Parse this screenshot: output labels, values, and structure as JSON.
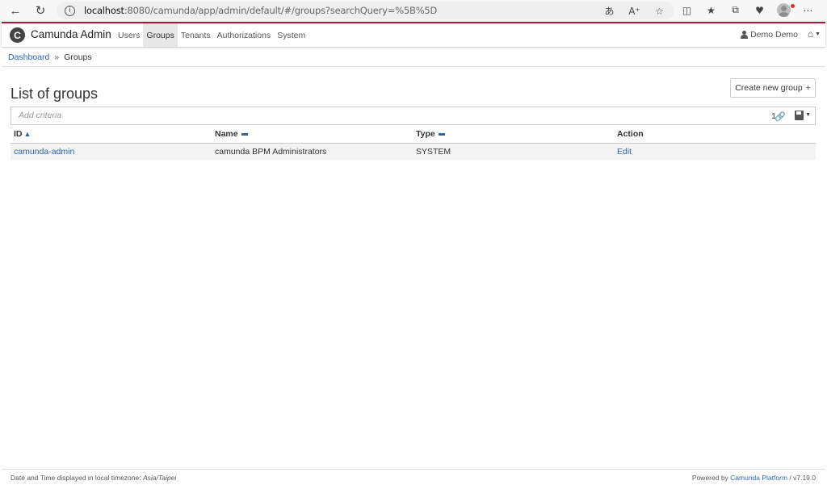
{
  "browser": {
    "url_host": "localhost",
    "url_rest": ":8080/camunda/app/admin/default/#/groups?searchQuery=%5B%5D"
  },
  "header": {
    "brand": "Camunda Admin",
    "nav": [
      "Users",
      "Groups",
      "Tenants",
      "Authorizations",
      "System"
    ],
    "active_nav": "Groups",
    "user": "Demo Demo"
  },
  "breadcrumb": {
    "dashboard": "Dashboard",
    "separator": "»",
    "current": "Groups"
  },
  "main": {
    "title": "List of groups",
    "create_button": "Create new group",
    "search_placeholder": "Add criteria",
    "result_count": "1"
  },
  "table": {
    "headers": [
      "ID",
      "Name",
      "Type",
      "Action"
    ],
    "rows": [
      {
        "id": "camunda-admin",
        "name": "camunda BPM Administrators",
        "type": "SYSTEM",
        "action": "Edit"
      }
    ]
  },
  "footer": {
    "left_prefix": "Date and Time displayed in local timezone: ",
    "timezone": "Asia/Taipei",
    "right_prefix": "Powered by ",
    "right_link": "Camunda Platform",
    "version": " / v7.19.0"
  },
  "colors": {
    "accent": "#b5152b",
    "link": "#2a67b0"
  }
}
